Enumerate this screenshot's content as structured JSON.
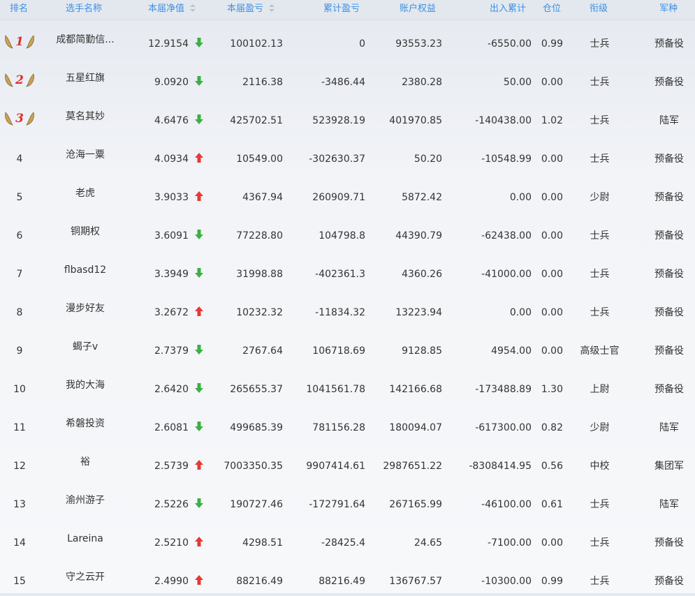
{
  "headers": {
    "rank": "排名",
    "name": "选手名称",
    "nav": "本届净值",
    "pnl": "本届盈亏",
    "cum_pnl": "累计盈亏",
    "equity": "账户权益",
    "inout": "出入累计",
    "position": "仓位",
    "grade": "衔级",
    "arm": "军种"
  },
  "colors": {
    "up": "#e53935",
    "down": "#3cb043",
    "header_text": "#3d8fe0"
  },
  "rows": [
    {
      "rank": "1",
      "medal": true,
      "name": "成都简勤信...",
      "nav": "12.9154",
      "dir": "down",
      "pnl": "100102.13",
      "cum": "0",
      "equity": "93553.23",
      "inout": "-6550.00",
      "pos": "0.99",
      "grade": "士兵",
      "arm": "预备役"
    },
    {
      "rank": "2",
      "medal": true,
      "name": "五星红旗",
      "nav": "9.0920",
      "dir": "down",
      "pnl": "2116.38",
      "cum": "-3486.44",
      "equity": "2380.28",
      "inout": "50.00",
      "pos": "0.00",
      "grade": "士兵",
      "arm": "预备役"
    },
    {
      "rank": "3",
      "medal": true,
      "name": "莫名其妙",
      "nav": "4.6476",
      "dir": "down",
      "pnl": "425702.51",
      "cum": "523928.19",
      "equity": "401970.85",
      "inout": "-140438.00",
      "pos": "1.02",
      "grade": "士兵",
      "arm": "陆军"
    },
    {
      "rank": "4",
      "name": "沧海一粟",
      "nav": "4.0934",
      "dir": "up",
      "pnl": "10549.00",
      "cum": "-302630.37",
      "equity": "50.20",
      "inout": "-10548.99",
      "pos": "0.00",
      "grade": "士兵",
      "arm": "预备役"
    },
    {
      "rank": "5",
      "name": "老虎",
      "nav": "3.9033",
      "dir": "up",
      "pnl": "4367.94",
      "cum": "260909.71",
      "equity": "5872.42",
      "inout": "0.00",
      "pos": "0.00",
      "grade": "少尉",
      "arm": "预备役"
    },
    {
      "rank": "6",
      "name": "铜期权",
      "nav": "3.6091",
      "dir": "down",
      "pnl": "77228.80",
      "cum": "104798.8",
      "equity": "44390.79",
      "inout": "-62438.00",
      "pos": "0.00",
      "grade": "士兵",
      "arm": "预备役"
    },
    {
      "rank": "7",
      "name": "flbasd12",
      "nav": "3.3949",
      "dir": "down",
      "pnl": "31998.88",
      "cum": "-402361.3",
      "equity": "4360.26",
      "inout": "-41000.00",
      "pos": "0.00",
      "grade": "士兵",
      "arm": "预备役"
    },
    {
      "rank": "8",
      "name": "漫步好友",
      "nav": "3.2672",
      "dir": "up",
      "pnl": "10232.32",
      "cum": "-11834.32",
      "equity": "13223.94",
      "inout": "0.00",
      "pos": "0.00",
      "grade": "士兵",
      "arm": "预备役"
    },
    {
      "rank": "9",
      "name": "蝎子v",
      "nav": "2.7379",
      "dir": "down",
      "pnl": "2767.64",
      "cum": "106718.69",
      "equity": "9128.85",
      "inout": "4954.00",
      "pos": "0.00",
      "grade": "高级士官",
      "arm": "预备役"
    },
    {
      "rank": "10",
      "name": "我的大海",
      "nav": "2.6420",
      "dir": "down",
      "pnl": "265655.37",
      "cum": "1041561.78",
      "equity": "142166.68",
      "inout": "-173488.89",
      "pos": "1.30",
      "grade": "上尉",
      "arm": "预备役"
    },
    {
      "rank": "11",
      "name": "希磐投资",
      "nav": "2.6081",
      "dir": "down",
      "pnl": "499685.39",
      "cum": "781156.28",
      "equity": "180094.07",
      "inout": "-617300.00",
      "pos": "0.82",
      "grade": "少尉",
      "arm": "陆军"
    },
    {
      "rank": "12",
      "name": "裕",
      "nav": "2.5739",
      "dir": "up",
      "pnl": "7003350.35",
      "cum": "9907414.61",
      "equity": "2987651.22",
      "inout": "-8308414.95",
      "pos": "0.56",
      "grade": "中校",
      "arm": "集团军"
    },
    {
      "rank": "13",
      "name": "渝州游子",
      "nav": "2.5226",
      "dir": "down",
      "pnl": "190727.46",
      "cum": "-172791.64",
      "equity": "267165.99",
      "inout": "-46100.00",
      "pos": "0.61",
      "grade": "士兵",
      "arm": "陆军"
    },
    {
      "rank": "14",
      "name": "Lareina",
      "nav": "2.5210",
      "dir": "up",
      "pnl": "4298.51",
      "cum": "-28425.4",
      "equity": "24.65",
      "inout": "-7100.00",
      "pos": "0.00",
      "grade": "士兵",
      "arm": "预备役"
    },
    {
      "rank": "15",
      "name": "守之云开",
      "nav": "2.4990",
      "dir": "up",
      "pnl": "88216.49",
      "cum": "88216.49",
      "equity": "136767.57",
      "inout": "-10300.00",
      "pos": "0.99",
      "grade": "士兵",
      "arm": "预备役"
    }
  ]
}
